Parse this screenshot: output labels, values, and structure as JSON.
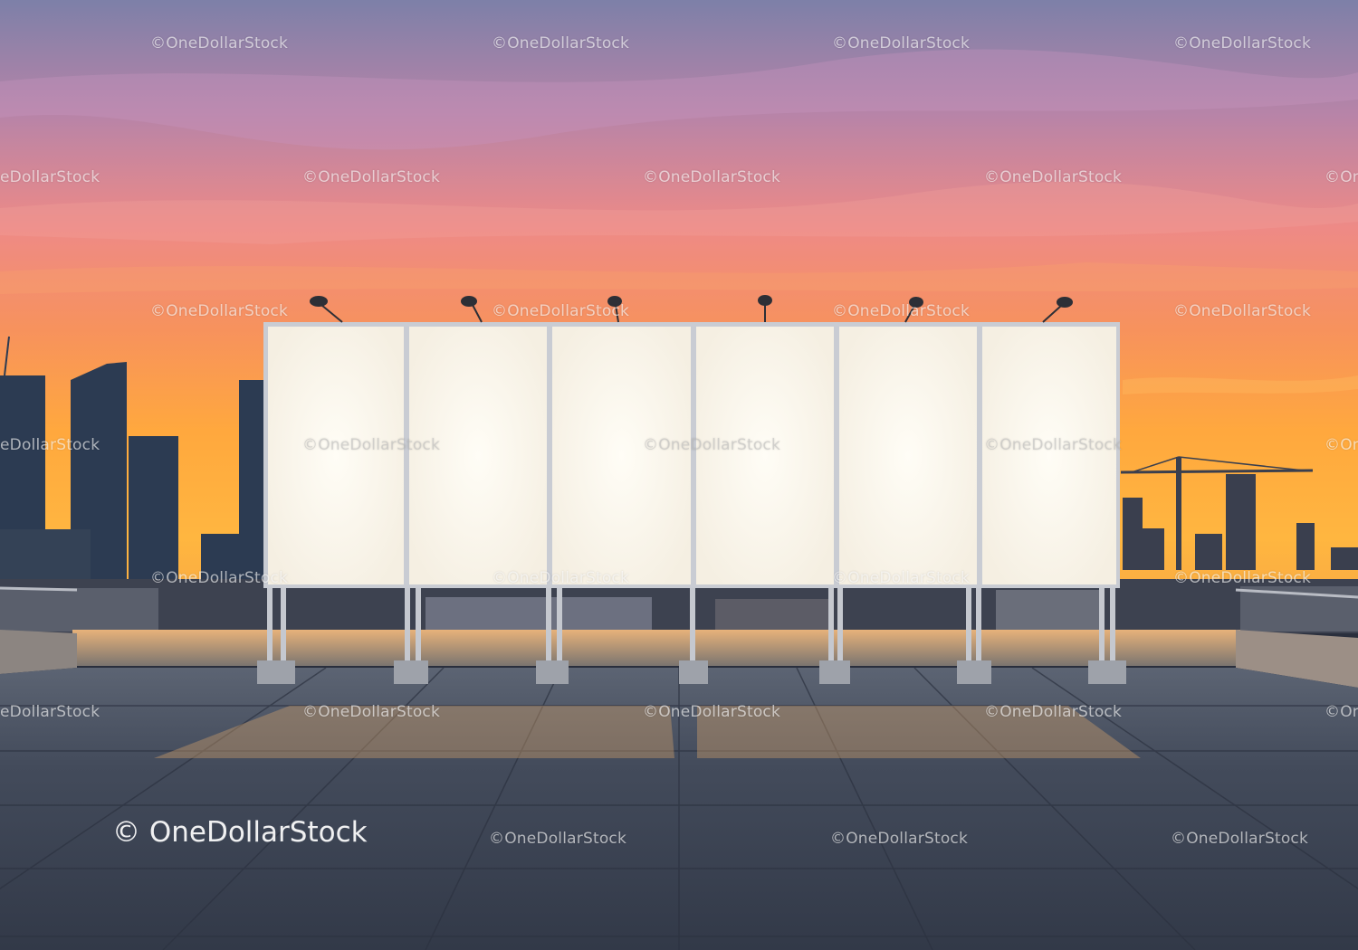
{
  "watermark": {
    "text": "©OneDollarStock",
    "large_text": "© OneDollarStock",
    "partial_left": "eDollarStock",
    "partial_right": "©On"
  },
  "colors": {
    "sky_top": "#8a7fa6",
    "sky_mid": "#f08a70",
    "sky_horizon": "#ffb13b",
    "billboard_panel": "#fffaf0",
    "frame": "#c9ccd3",
    "rooftop": "#3c4454"
  },
  "billboard": {
    "panel_count": 6
  }
}
